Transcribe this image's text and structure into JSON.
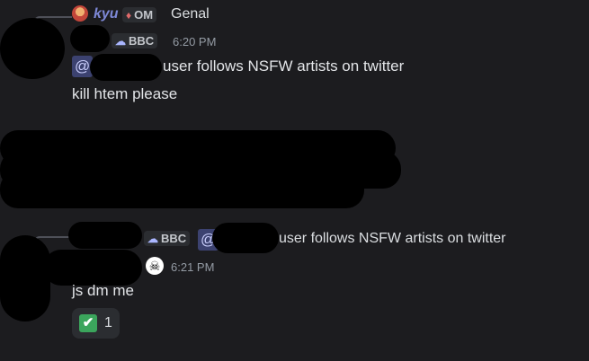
{
  "reply1": {
    "username": "kyu",
    "badge_label": "OM",
    "preview_text": "Genal"
  },
  "message1": {
    "tag_label": "BBC",
    "timestamp": "6:20 PM",
    "mention_symbol": "@",
    "line1_text": "user follows NSFW artists on twitter",
    "line2_text": "kill htem please"
  },
  "reply2": {
    "tag_label": "BBC",
    "mention_symbol": "@",
    "preview_text": "user follows NSFW artists on twitter"
  },
  "message2": {
    "timestamp": "6:21 PM",
    "text": "js dm me",
    "reaction": {
      "emoji": "✔",
      "count": "1"
    }
  },
  "colors": {
    "background": "#1c1c1f",
    "username_kyu": "#7d88d6",
    "mention_bg": "#3c4270",
    "reaction_check": "#3ba55c"
  },
  "icons": [
    "avatar-kyu",
    "gem-icon",
    "cloud-icon",
    "skull-icon",
    "check-icon"
  ]
}
